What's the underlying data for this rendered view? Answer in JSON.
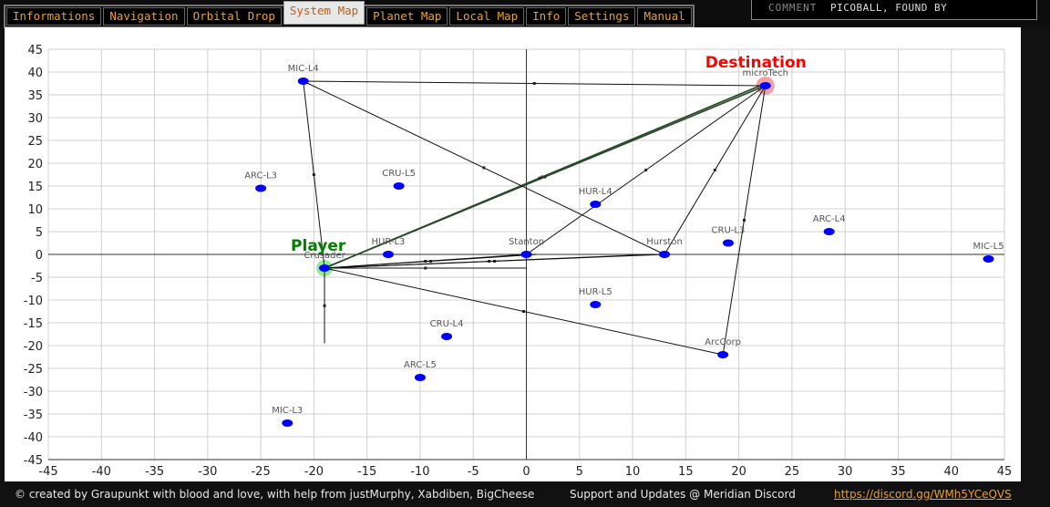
{
  "tabs": [
    {
      "label": "Informations",
      "active": false
    },
    {
      "label": "Navigation",
      "active": false
    },
    {
      "label": "Orbital Drop",
      "active": false
    },
    {
      "label": "System Map",
      "active": true
    },
    {
      "label": "Planet Map",
      "active": false
    },
    {
      "label": "Local Map",
      "active": false
    },
    {
      "label": "Info",
      "active": false
    },
    {
      "label": "Settings",
      "active": false
    },
    {
      "label": "Manual",
      "active": false
    }
  ],
  "comment": {
    "label": "COMMENT",
    "value": "PICOBALL, FOUND BY"
  },
  "colors": {
    "accent": "#f0a020",
    "point": "#0000ff",
    "destination": "#ff0000",
    "player": "#008000"
  },
  "chart_data": {
    "type": "scatter",
    "xlim": [
      -45,
      45
    ],
    "ylim": [
      -45,
      45
    ],
    "xticks": [
      -45,
      -40,
      -35,
      -30,
      -25,
      -20,
      -15,
      -10,
      -5,
      0,
      5,
      10,
      15,
      20,
      25,
      30,
      35,
      40,
      45
    ],
    "yticks": [
      45,
      40,
      35,
      30,
      25,
      20,
      15,
      10,
      5,
      0,
      -5,
      -10,
      -15,
      -20,
      -25,
      -30,
      -35,
      -40,
      -45
    ],
    "grid": true,
    "points": [
      {
        "name": "MIC-L4",
        "x": -21,
        "y": 38
      },
      {
        "name": "microTech",
        "x": 22.5,
        "y": 37
      },
      {
        "name": "ARC-L3",
        "x": -25,
        "y": 14.5
      },
      {
        "name": "CRU-L5",
        "x": -12,
        "y": 15
      },
      {
        "name": "HUR-L4",
        "x": 6.5,
        "y": 11
      },
      {
        "name": "CRU-L3",
        "x": 19,
        "y": 2.5
      },
      {
        "name": "ARC-L4",
        "x": 28.5,
        "y": 5
      },
      {
        "name": "MIC-L5",
        "x": 43.5,
        "y": -1
      },
      {
        "name": "HUR-L3",
        "x": -13,
        "y": 0
      },
      {
        "name": "Crusader",
        "x": -19,
        "y": -3
      },
      {
        "name": "Stanton",
        "x": 0,
        "y": 0
      },
      {
        "name": "Hurston",
        "x": 13,
        "y": 0
      },
      {
        "name": "HUR-L5",
        "x": 6.5,
        "y": -11
      },
      {
        "name": "CRU-L4",
        "x": -7.5,
        "y": -18
      },
      {
        "name": "ARC-L5",
        "x": -10,
        "y": -27
      },
      {
        "name": "ArcCorp",
        "x": 18.5,
        "y": -22
      },
      {
        "name": "MIC-L3",
        "x": -22.5,
        "y": -37
      }
    ],
    "annotations": [
      {
        "text": "Destination",
        "x": 22.5,
        "y": 37
      },
      {
        "text": "Player",
        "x": -19,
        "y": -3
      }
    ],
    "routes": [
      [
        [
          -19,
          -3
        ],
        [
          22.5,
          37
        ]
      ],
      [
        [
          -19,
          -3
        ],
        [
          22,
          37
        ]
      ],
      [
        [
          -19,
          -3
        ],
        [
          21.5,
          36.5
        ]
      ],
      [
        [
          -19,
          -3
        ],
        [
          -21,
          38
        ],
        [
          22.5,
          37
        ]
      ],
      [
        [
          -21,
          38
        ],
        [
          13,
          0
        ]
      ],
      [
        [
          -19,
          -3
        ],
        [
          13,
          0
        ],
        [
          22.5,
          37
        ]
      ],
      [
        [
          -19,
          -3
        ],
        [
          0,
          0
        ],
        [
          22.5,
          37
        ]
      ],
      [
        [
          -19,
          -3
        ],
        [
          18.5,
          -22
        ],
        [
          22.5,
          37
        ]
      ],
      [
        [
          -19,
          -3
        ],
        [
          -19,
          -19.5
        ]
      ],
      [
        [
          -19,
          -3
        ],
        [
          0,
          -3
        ]
      ],
      [
        [
          -19,
          -3
        ],
        [
          12,
          0
        ]
      ],
      [
        [
          -19,
          -3
        ],
        [
          1,
          0
        ]
      ]
    ]
  },
  "footer": {
    "credits": "© created by Graupunkt with blood and love, with help from justMurphy, Xabdiben, BigCheese",
    "support": "Support and Updates @ Meridian Discord",
    "discord_link": "https://discord.gg/WMh5YCeQVS"
  }
}
